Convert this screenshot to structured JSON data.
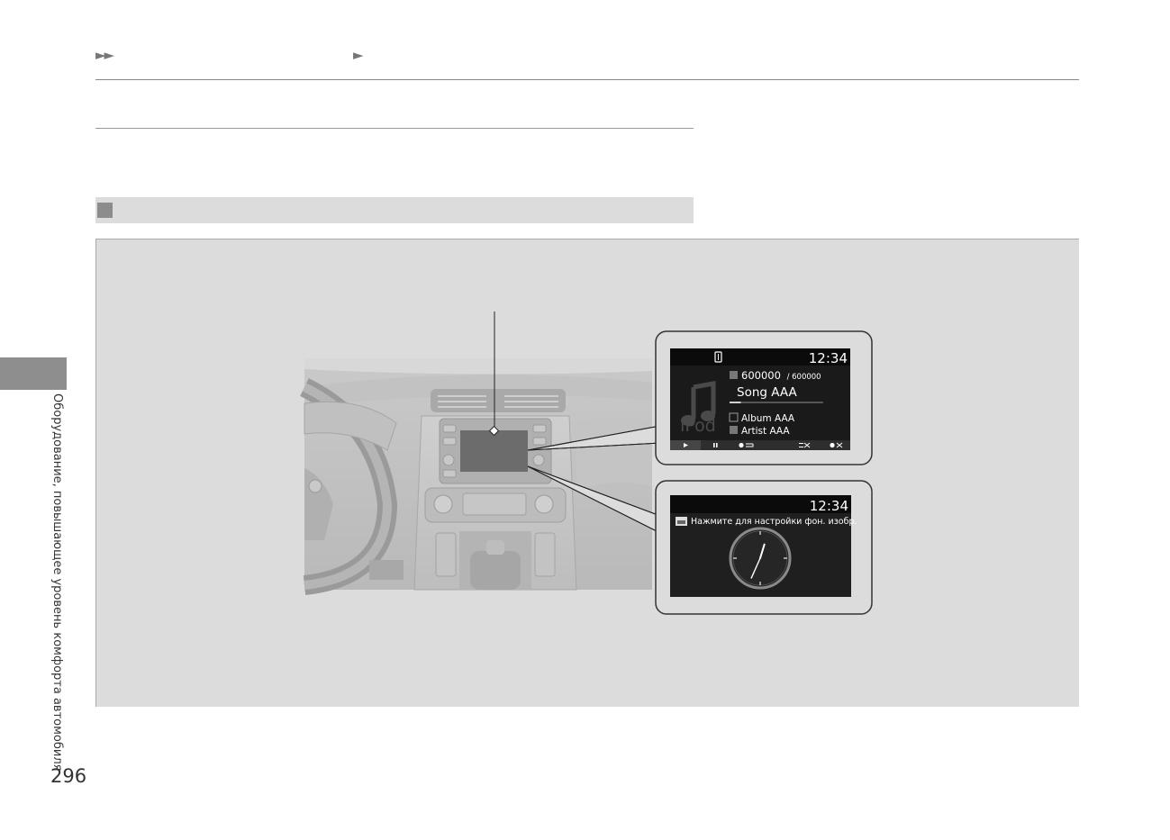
{
  "page": {
    "side_label": "Оборудование, повышающее уровень комфорта автомобиля",
    "page_number": "296"
  },
  "breadcrumb": {
    "arrow1": "►►",
    "arrow2": "►"
  },
  "audio_screen": {
    "clock": "12:34",
    "track_counter": "600000",
    "track_total": "/ 600000",
    "song": "Song AAA",
    "album": "Album AAA",
    "artist": "Artist AAA",
    "source_logo": "iPod",
    "progress": 0.12,
    "controls": [
      "play-icon",
      "pause-icon",
      "repeat-icon",
      "shuffle-icon",
      "shuffle-all-icon"
    ]
  },
  "clock_screen": {
    "clock": "12:34",
    "message": "Нажмите для настройки фон. изобр.",
    "hour": 12,
    "minute": 34
  },
  "colors": {
    "panel_bg": "#dcdcdc",
    "screen_bg": "#1a1a1a",
    "callout_border": "#333333"
  }
}
